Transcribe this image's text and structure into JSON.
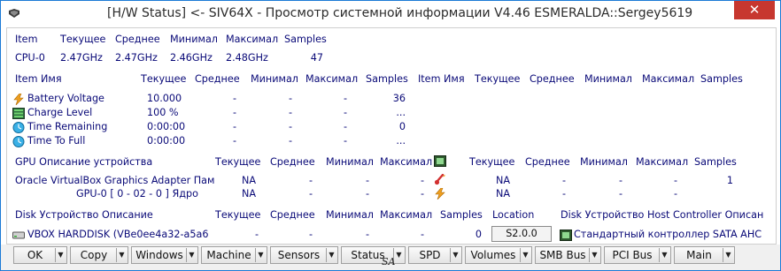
{
  "window": {
    "title": "[H/W Status] <- SIV64X - Просмотр системной информации V4.46 ESMERALDA::Sergey5619",
    "close_glyph": "✕"
  },
  "cpu": {
    "headers": [
      "Item",
      "Текущее",
      "Среднее",
      "Минимал",
      "Максимал",
      "Samples"
    ],
    "row": [
      "CPU-0",
      "2.47GHz",
      "2.47GHz",
      "2.46GHz",
      "2.48GHz",
      "47"
    ]
  },
  "battery": {
    "headers": [
      "Item Имя",
      "Текущее",
      "Среднее",
      "Минимал",
      "Максимал",
      "Samples"
    ],
    "headers_right": [
      "Item Имя",
      "Текущее",
      "Среднее",
      "Минимал",
      "Максимал",
      "Samples"
    ],
    "rows": [
      {
        "name": "Battery Voltage",
        "cur": "10.000",
        "avg": "-",
        "min": "-",
        "max": "-",
        "samples": "36",
        "icon": "lightning-icon"
      },
      {
        "name": "Charge Level",
        "cur": "100 %",
        "avg": "-",
        "min": "-",
        "max": "-",
        "samples": "...",
        "icon": "battery-level-icon"
      },
      {
        "name": "Time Remaining",
        "cur": "0:00:00",
        "avg": "-",
        "min": "-",
        "max": "-",
        "samples": "0",
        "icon": "clock-icon"
      },
      {
        "name": "Time To Full",
        "cur": "0:00:00",
        "avg": "-",
        "min": "-",
        "max": "-",
        "samples": "...",
        "icon": "clock-icon"
      }
    ]
  },
  "gpu": {
    "headers": [
      "GPU Описание устройства",
      "Текущее",
      "Среднее",
      "Минимал",
      "Максимал"
    ],
    "headers_right": [
      "Текущее",
      "Среднее",
      "Минимал",
      "Максимал",
      "Samples"
    ],
    "rows": [
      {
        "name": "Oracle VirtualBox Graphics Adapter Пам",
        "cur": "NA",
        "avg": "-",
        "min": "-",
        "max": "-",
        "r_cur": "NA",
        "r_avg": "-",
        "r_min": "-",
        "r_max": "-",
        "r_samples": "1"
      },
      {
        "name": "GPU-0 [ 0 - 02 - 0 ] Ядро",
        "cur": "NA",
        "avg": "-",
        "min": "-",
        "max": "-",
        "r_cur": "NA",
        "r_avg": "-",
        "r_min": "-",
        "r_max": "-",
        "r_samples": ""
      }
    ]
  },
  "disk": {
    "headers": [
      "Disk Устройство Описание",
      "Текущее",
      "Среднее",
      "Минимал",
      "Максимал",
      "Samples",
      "Location",
      "Disk Устройство Host Controller Описан"
    ],
    "row": {
      "name": "VBOX HARDDISK (VBe0ee4a32-a5a6",
      "cur": "-",
      "avg": "-",
      "min": "-",
      "max": "-",
      "samples": "0",
      "location": "S2.0.0",
      "controller": "Стандартный контроллер SATA AHC"
    }
  },
  "buttons": [
    "OK",
    "Copy",
    "Windows",
    "Machine",
    "Sensors",
    "Status",
    "SPD",
    "Volumes",
    "SMB Bus",
    "PCI Bus",
    "Main"
  ],
  "watermark": "SA",
  "colors": {
    "text": "#0a0a78",
    "close": "#c7372f",
    "border": "#1b7ad6"
  }
}
